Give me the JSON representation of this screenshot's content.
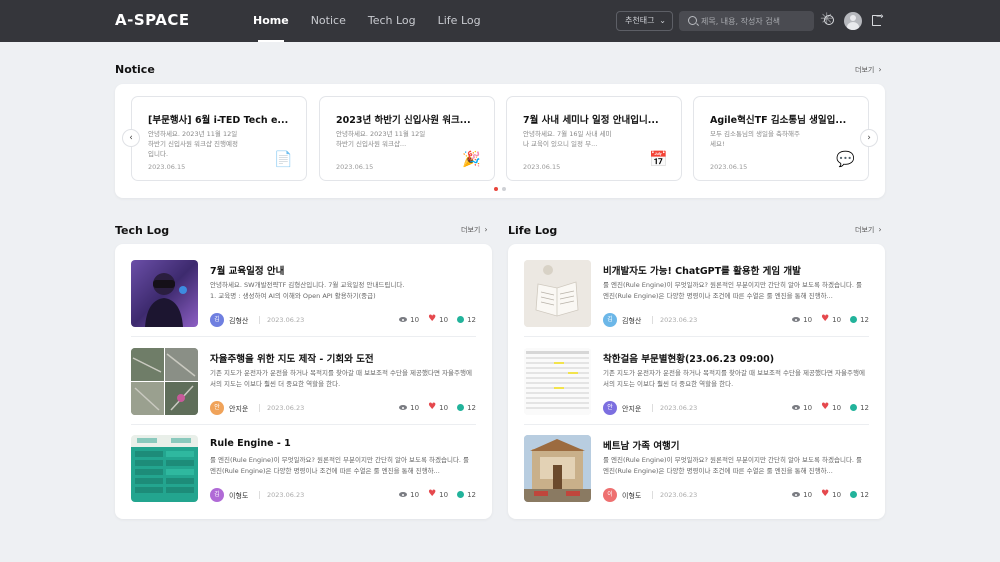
{
  "header": {
    "logo": "A-SPACE",
    "nav": [
      "Home",
      "Notice",
      "Tech Log",
      "Life Log"
    ],
    "tag_select": "추천태그",
    "search_placeholder": "제목, 내용, 작성자 검색"
  },
  "notice": {
    "title": "Notice",
    "more": "더보기",
    "cards": [
      {
        "title": "[부문행사] 6월 i-TED Tech e...",
        "desc": "안녕하세요. 2023년 11월 12일 하반기 신입사원 워크샵 진행예정입니다.",
        "date": "2023.06.15",
        "icon": "📄"
      },
      {
        "title": "2023년 하반기 신입사원 워크...",
        "desc": "안녕하세요. 2023년 11월 12일 하반기 신입사원 워크샵...",
        "date": "2023.06.15",
        "icon": "🎉"
      },
      {
        "title": "7월 사내 세미나 일정 안내입니...",
        "desc": "안녕하세요. 7월 16일 사내 세미나 교육이 있으니 일정 부...",
        "date": "2023.06.15",
        "icon": "📅"
      },
      {
        "title": "Agile혁신TF 김소통님 생일입...",
        "desc": "모두 김소통님의 생일을 축하해주세요!",
        "date": "2023.06.15",
        "icon": "💬"
      }
    ]
  },
  "tech_log": {
    "title": "Tech Log",
    "more": "더보기",
    "posts": [
      {
        "title": "7월 교육일정 안내",
        "desc": "안녕하세요. SW개발전략TF 김형산입니다. 7월 교육일정 안내드립니다.\n  1. 교육명 : 생성하여 AI의 이해와 Open API 활용하기(중급)",
        "avatar": "김",
        "author": "김형산",
        "date": "2023.06.23",
        "views": "10",
        "likes": "10",
        "comments": "12"
      },
      {
        "title": "자율주행을 위한 지도 제작 - 기회와 도전",
        "desc": "기존 지도가 운전자가 운전을 하거나 목적지를 찾아갈 때 보보조적 수단을 제공했다면 자율주행에서의 지도는 이보다 훨씬 더 중요한 역할을 한다.",
        "avatar": "안",
        "author": "안지운",
        "date": "2023.06.23",
        "views": "10",
        "likes": "10",
        "comments": "12"
      },
      {
        "title": "Rule Engine - 1",
        "desc": "룰 엔진(Rule Engine)이 무엇일까요? 원론적인 부분이지만 간단히 알아 보도록 하겠습니다. 룰 엔진(Rule Engine)은 다양한 명령이나 조건에 따른 수열은 룰 엔진을 통해 진행하...",
        "avatar": "김",
        "author": "이형도",
        "date": "2023.06.23",
        "views": "10",
        "likes": "10",
        "comments": "12"
      }
    ]
  },
  "life_log": {
    "title": "Life Log",
    "more": "더보기",
    "posts": [
      {
        "title": "비개발자도 가능! ChatGPT를 활용한 게임 개발",
        "desc": "룰 엔진(Rule Engine)이 무엇일까요? 원론적인 부분이지만 간단히 알아 보도록 하겠습니다. 룰 엔진(Rule Engine)은 다양한 명령이나 조건에 따른 수열은 룰 엔진을 통해 진행하...",
        "avatar": "김",
        "author": "김형산",
        "date": "2023.06.23",
        "views": "10",
        "likes": "10",
        "comments": "12"
      },
      {
        "title": "착한걸음 부문별현황(23.06.23 09:00)",
        "desc": "기존 지도가 운전자가 운전을 하거나 목적지를 찾아갈 때 보보조적 수단을 제공했다면 자율주행에서의 지도는 이보다 훨씬 더 중요한 역할을 한다.",
        "avatar": "안",
        "author": "안지운",
        "date": "2023.06.23",
        "views": "10",
        "likes": "10",
        "comments": "12"
      },
      {
        "title": "베트남 가족 여행기",
        "desc": "룰 엔진(Rule Engine)이 무엇일까요? 원론적인 부분이지만 간단히 알아 보도록 하겠습니다. 룰 엔진(Rule Engine)은 다양한 명령이나 조건에 따른 수열은 룰 엔진을 통해 진행하...",
        "avatar": "이",
        "author": "이형도",
        "date": "2023.06.23",
        "views": "10",
        "likes": "10",
        "comments": "12"
      }
    ]
  },
  "colors": {
    "avatar_blue": "#6f7fe0",
    "avatar_orange": "#f0a35a",
    "avatar_purple": "#b06ad6",
    "avatar_sky": "#6cb7e8",
    "avatar_indigo": "#7c6fe0",
    "avatar_red": "#ee7070"
  }
}
